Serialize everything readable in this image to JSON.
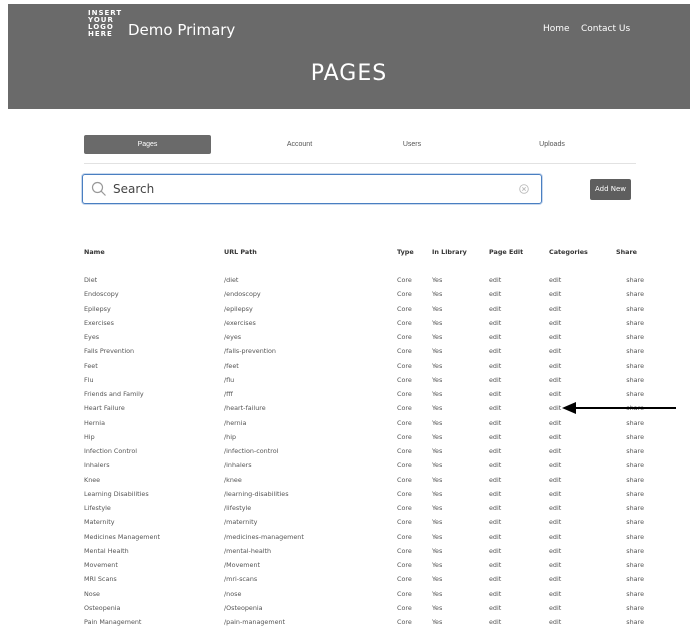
{
  "header": {
    "logo_lines": [
      "INSERT",
      "YOUR",
      "LOGO",
      "HERE"
    ],
    "brand": "Demo Primary",
    "nav": [
      "Home",
      "Contact Us"
    ],
    "title": "PAGES"
  },
  "tabs": [
    "Pages",
    "Account",
    "Users",
    "Uploads"
  ],
  "search": {
    "placeholder": "Search"
  },
  "add_button": "Add New",
  "table": {
    "columns": [
      "Name",
      "URL Path",
      "Type",
      "In Library",
      "Page Edit",
      "Categories",
      "Share"
    ],
    "rows": [
      [
        "Diet",
        "/diet",
        "Core",
        "Yes",
        "edit",
        "edit",
        "share"
      ],
      [
        "Endoscopy",
        "/endoscopy",
        "Core",
        "Yes",
        "edit",
        "edit",
        "share"
      ],
      [
        "Epilepsy",
        "/epilepsy",
        "Core",
        "Yes",
        "edit",
        "edit",
        "share"
      ],
      [
        "Exercises",
        "/exercises",
        "Core",
        "Yes",
        "edit",
        "edit",
        "share"
      ],
      [
        "Eyes",
        "/eyes",
        "Core",
        "Yes",
        "edit",
        "edit",
        "share"
      ],
      [
        "Falls Prevention",
        "/falls-prevention",
        "Core",
        "Yes",
        "edit",
        "edit",
        "share"
      ],
      [
        "Feet",
        "/feet",
        "Core",
        "Yes",
        "edit",
        "edit",
        "share"
      ],
      [
        "Flu",
        "/flu",
        "Core",
        "Yes",
        "edit",
        "edit",
        "share"
      ],
      [
        "Friends and Family",
        "/fff",
        "Core",
        "Yes",
        "edit",
        "edit",
        "share"
      ],
      [
        "Heart Failure",
        "/heart-failure",
        "Core",
        "Yes",
        "edit",
        "edit",
        "share"
      ],
      [
        "Hernia",
        "/hernia",
        "Core",
        "Yes",
        "edit",
        "edit",
        "share"
      ],
      [
        "Hip",
        "/hip",
        "Core",
        "Yes",
        "edit",
        "edit",
        "share"
      ],
      [
        "Infection Control",
        "/infection-control",
        "Core",
        "Yes",
        "edit",
        "edit",
        "share"
      ],
      [
        "Inhalers",
        "/inhalers",
        "Core",
        "Yes",
        "edit",
        "edit",
        "share"
      ],
      [
        "Knee",
        "/knee",
        "Core",
        "Yes",
        "edit",
        "edit",
        "share"
      ],
      [
        "Learning Disabilities",
        "/learning-disabilities",
        "Core",
        "Yes",
        "edit",
        "edit",
        "share"
      ],
      [
        "Lifestyle",
        "/lifestyle",
        "Core",
        "Yes",
        "edit",
        "edit",
        "share"
      ],
      [
        "Maternity",
        "/maternity",
        "Core",
        "Yes",
        "edit",
        "edit",
        "share"
      ],
      [
        "Medicines Management",
        "/medicines-management",
        "Core",
        "Yes",
        "edit",
        "edit",
        "share"
      ],
      [
        "Mental Health",
        "/mental-health",
        "Core",
        "Yes",
        "edit",
        "edit",
        "share"
      ],
      [
        "Movement",
        "/Movement",
        "Core",
        "Yes",
        "edit",
        "edit",
        "share"
      ],
      [
        "MRI Scans",
        "/mri-scans",
        "Core",
        "Yes",
        "edit",
        "edit",
        "share"
      ],
      [
        "Nose",
        "/nose",
        "Core",
        "Yes",
        "edit",
        "edit",
        "share"
      ],
      [
        "Osteopenia",
        "/Osteopenia",
        "Core",
        "Yes",
        "edit",
        "edit",
        "share"
      ],
      [
        "Pain Management",
        "/pain-management",
        "Core",
        "Yes",
        "edit",
        "edit",
        "share"
      ]
    ]
  }
}
